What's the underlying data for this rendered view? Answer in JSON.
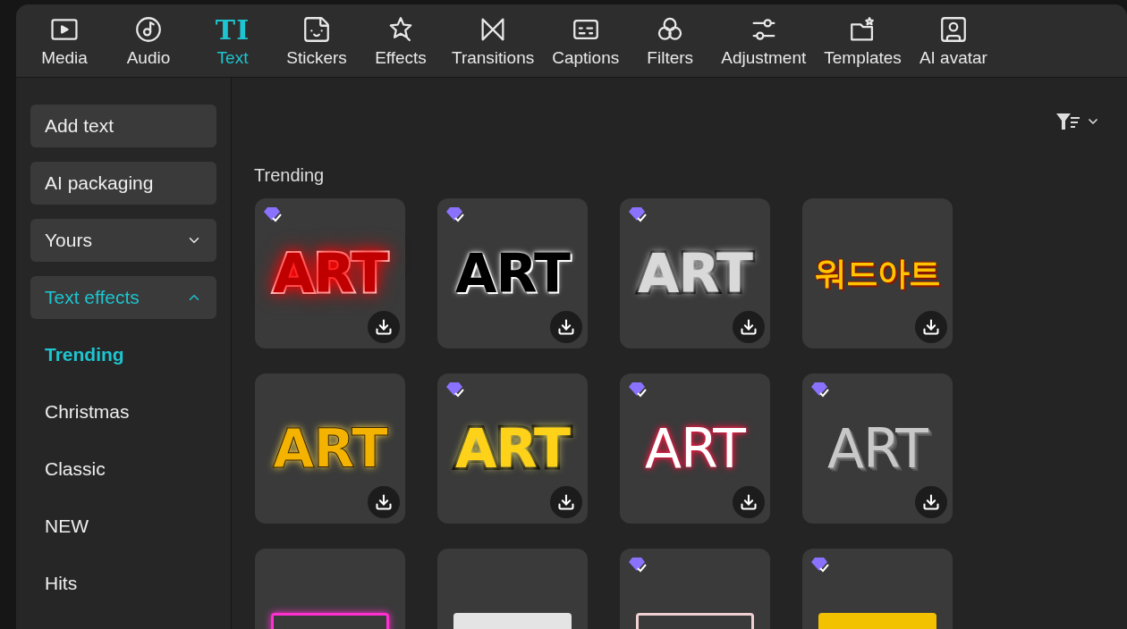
{
  "toolbar": {
    "tabs": [
      {
        "label": "Media",
        "selected": false
      },
      {
        "label": "Audio",
        "selected": false
      },
      {
        "label": "Text",
        "glyph": "TI",
        "selected": true
      },
      {
        "label": "Stickers",
        "selected": false
      },
      {
        "label": "Effects",
        "selected": false
      },
      {
        "label": "Transitions",
        "selected": false
      },
      {
        "label": "Captions",
        "selected": false
      },
      {
        "label": "Filters",
        "selected": false
      },
      {
        "label": "Adjustment",
        "selected": false
      },
      {
        "label": "Templates",
        "selected": false
      },
      {
        "label": "AI avatar",
        "selected": false
      }
    ]
  },
  "sidebar": {
    "items": [
      {
        "kind": "button",
        "label": "Add text"
      },
      {
        "kind": "button",
        "label": "AI packaging"
      },
      {
        "kind": "group",
        "label": "Yours",
        "expanded": false,
        "selected": false
      },
      {
        "kind": "group",
        "label": "Text effects",
        "expanded": true,
        "selected": true,
        "children": [
          {
            "label": "Trending",
            "selected": true
          },
          {
            "label": "Christmas",
            "selected": false
          },
          {
            "label": "Classic",
            "selected": false
          },
          {
            "label": "NEW",
            "selected": false
          },
          {
            "label": "Hits",
            "selected": false
          }
        ]
      }
    ]
  },
  "content": {
    "section_title": "Trending",
    "tiles": [
      {
        "preview": "ART",
        "premium": true,
        "download": true
      },
      {
        "preview": "ART",
        "premium": true,
        "download": true
      },
      {
        "preview": "ART",
        "premium": true,
        "download": true
      },
      {
        "preview": "워드아트",
        "premium": false,
        "download": true
      },
      {
        "preview": "ART",
        "premium": false,
        "download": true
      },
      {
        "preview": "ART",
        "premium": true,
        "download": true
      },
      {
        "preview": "ART",
        "premium": true,
        "download": true
      },
      {
        "preview": "ART",
        "premium": true,
        "download": true
      },
      {
        "premium": false,
        "download": false
      },
      {
        "premium": false,
        "download": false
      },
      {
        "premium": true,
        "download": false
      },
      {
        "premium": true,
        "download": false
      }
    ]
  }
}
